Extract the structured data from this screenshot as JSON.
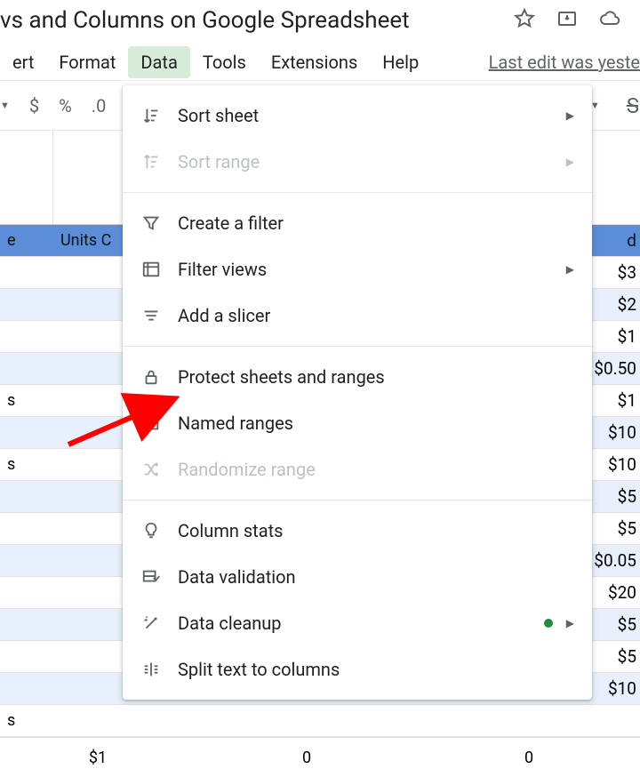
{
  "title": "vs and Columns on Google Spreadsheet",
  "menubar": {
    "insert": "ert",
    "format": "Format",
    "data": "Data",
    "tools": "Tools",
    "extensions": "Extensions",
    "help": "Help"
  },
  "last_edit": "Last edit was yeste",
  "toolbar": {
    "dollar": "$",
    "percent": "%",
    "decimal": ".0",
    "strike": "S"
  },
  "columns": {
    "a_header_fragment": "e",
    "b_header": "Units C",
    "last_header_fragment": "d"
  },
  "col_a_rows": [
    "",
    "",
    "",
    "",
    "s",
    "",
    "s",
    "",
    "",
    "",
    "",
    "",
    "",
    "",
    "s"
  ],
  "last_col_values": [
    "$3",
    "$2",
    "$1",
    "$0.50",
    "$1",
    "$10",
    "$10",
    "$5",
    "$5",
    "$0.05",
    "$20",
    "$5",
    "$5",
    "$10"
  ],
  "bottom_values": [
    "$1",
    "0",
    "0"
  ],
  "menu": {
    "sort_sheet": "Sort sheet",
    "sort_range": "Sort range",
    "create_filter": "Create a filter",
    "filter_views": "Filter views",
    "add_slicer": "Add a slicer",
    "protect": "Protect sheets and ranges",
    "named_ranges": "Named ranges",
    "randomize": "Randomize range",
    "column_stats": "Column stats",
    "data_validation": "Data validation",
    "data_cleanup": "Data cleanup",
    "split_text": "Split text to columns"
  }
}
